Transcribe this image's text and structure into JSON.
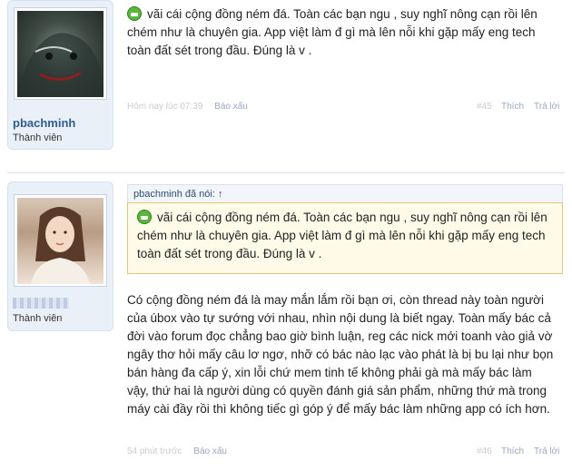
{
  "posts": [
    {
      "username": "pbachminh",
      "role": "Thành viên",
      "message": "vãi cái cộng đồng ném đá. Toàn các bạn ngu , suy nghĩ nông cạn rồi lên chém như là chuyên gia. App việt làm đ gì mà lên nỗi khi gặp mấy eng tech toàn đất sét trong đầu. Đúng là v .",
      "time": "Hôm nay lúc 07:39",
      "report": "Báo xấu",
      "number": "#45",
      "like": "Thích",
      "reply": "Trả lời"
    },
    {
      "username": "",
      "role": "Thành viên",
      "quote_author": "pbachminh đã nói: ↑",
      "quote_text": "vãi cái cộng đồng ném đá. Toàn các bạn ngu , suy nghĩ nông cạn rồi lên chém như là chuyên gia. App việt làm đ gì mà lên nỗi khi gặp mấy eng tech toàn đất sét trong đầu. Đúng là v .",
      "message": "Có cộng đồng ném đá là may mắn lắm rồi bạn ơi, còn thread này toàn người của úbox vào tự sướng với nhau, nhìn nội dung là biết ngay. Toàn mấy bác cả đời vào forum đọc chẳng bao giờ bình luận, reg các nick mới toanh vào giả vờ ngây thơ hỏi mấy câu lơ ngơ, nhỡ có bác nào lạc vào phát là bị bu lại như bọn bán hàng đa cấp ý, xin lỗi chứ mem tinh tế không phải gà mà mấy bác làm vậy, thứ hai là người dùng có quyền đánh giá sản phẩm, những thứ mà trong máy cài đầy rồi thì không tiếc gì góp ý để mấy bác làm những app có ích hơn.",
      "time": "54 phút trước",
      "report": "Báo xấu",
      "number": "#46",
      "like": "Thích",
      "reply": "Trả lời"
    }
  ],
  "colors": {
    "username": "#2f5c8f",
    "sidebar_bg": "#eaf0f8",
    "quote_bg": "#fffbe8"
  }
}
